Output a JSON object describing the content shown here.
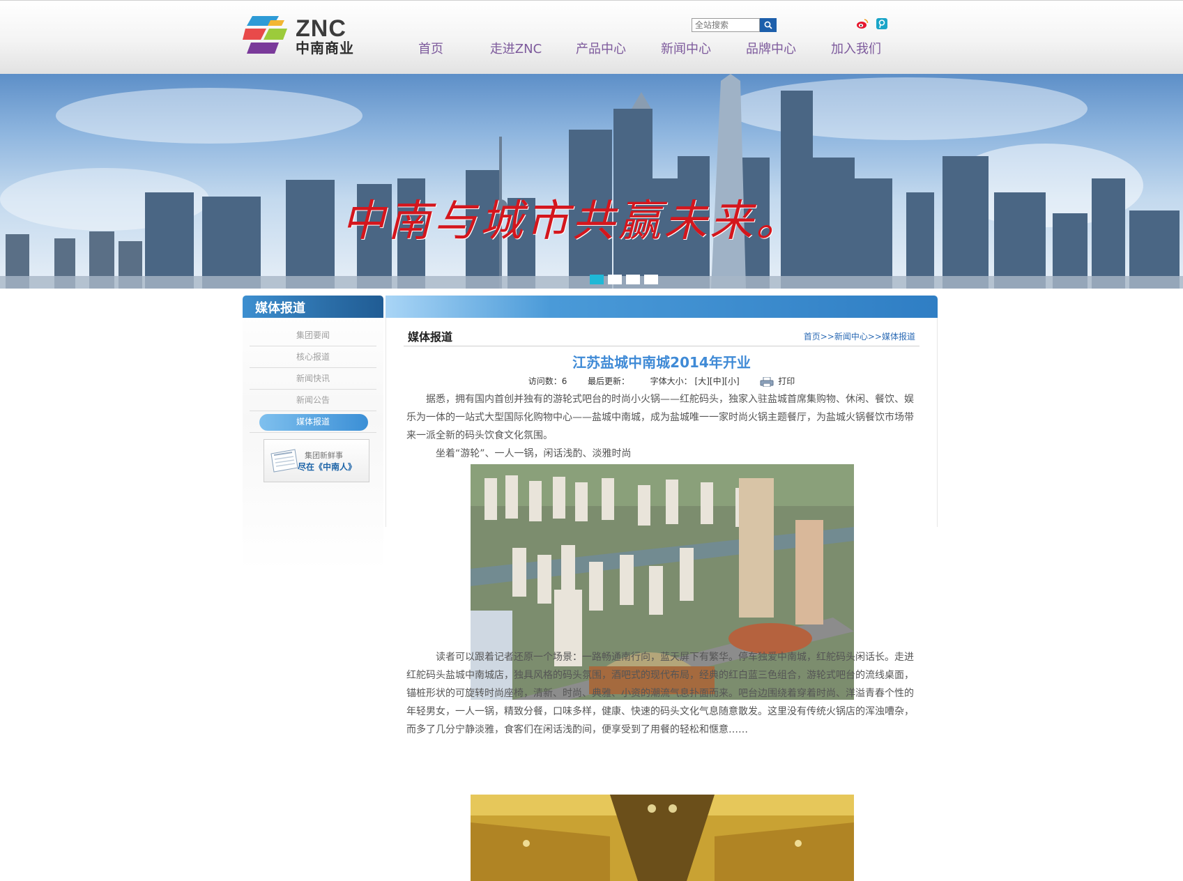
{
  "header": {
    "logo_en": "ZNC",
    "logo_cn": "中南商业",
    "search_placeholder": "全站搜索",
    "nav": [
      "首页",
      "走进ZNC",
      "产品中心",
      "新闻中心",
      "品牌中心",
      "加入我们"
    ]
  },
  "banner": {
    "slogan": "中南与城市共赢未来。",
    "slides": 4,
    "active_slide": 1
  },
  "sidebar": {
    "title": "媒体报道",
    "items": [
      "集团要闻",
      "核心报道",
      "新闻快讯",
      "新闻公告",
      "媒体报道"
    ],
    "active_index": 4,
    "promo_line1": "集团新鲜事",
    "promo_line2": "尽在《中南人》"
  },
  "article": {
    "section_title": "媒体报道",
    "breadcrumb": [
      "首页",
      "新闻中心",
      "媒体报道"
    ],
    "breadcrumb_sep": ">>",
    "title": "江苏盐城中南城2014年开业",
    "visits_label": "访问数：",
    "visits": "6",
    "updated_label": "最后更新：",
    "font_label": "字体大小：",
    "font_large": "[大]",
    "font_medium": "[中]",
    "font_small": "[小]",
    "print_label": "打印",
    "para1": "据悉，拥有国内首创并独有的游轮式吧台的时尚小火锅——红舵码头，独家入驻盐城首席集购物、休闲、餐饮、娱乐为一体的一站式大型国际化购物中心——盐城中南城，成为盐城唯一一家时尚火锅主题餐厅，为盐城火锅餐饮市场带来一派全新的码头饮食文化氛围。",
    "para2": "坐着“游轮”、一人一锅，闲话浅酌、淡雅时尚",
    "para3": "读者可以跟着记者还原一个场景：一路畅通南行向，蓝天屏下有繁华。停车独爱中南城，红舵码头闲话长。走进红舵码头盐城中南城店，独具风格的码头氛围，酒吧式的现代布局，经典的红白蓝三色组合，游轮式吧台的流线桌面，锚桩形状的可旋转时尚座椅，清新、时尚、典雅、小资的潮流气息扑面而来。吧台边围绕着穿着时尚、洋溢青春个性的年轻男女，一人一锅，精致分餐，口味多样，健康、快速的码头文化气息随意散发。这里没有传统火锅店的浑浊嘈杂，而多了几分宁静淡雅，食客们在闲话浅酌间，便享受到了用餐的轻松和惬意……"
  },
  "colors": {
    "nav_text": "#7d5a9c",
    "accent_blue": "#2c6bb5",
    "title_blue": "#3f8ad6",
    "slogan_red": "#d4161d"
  }
}
